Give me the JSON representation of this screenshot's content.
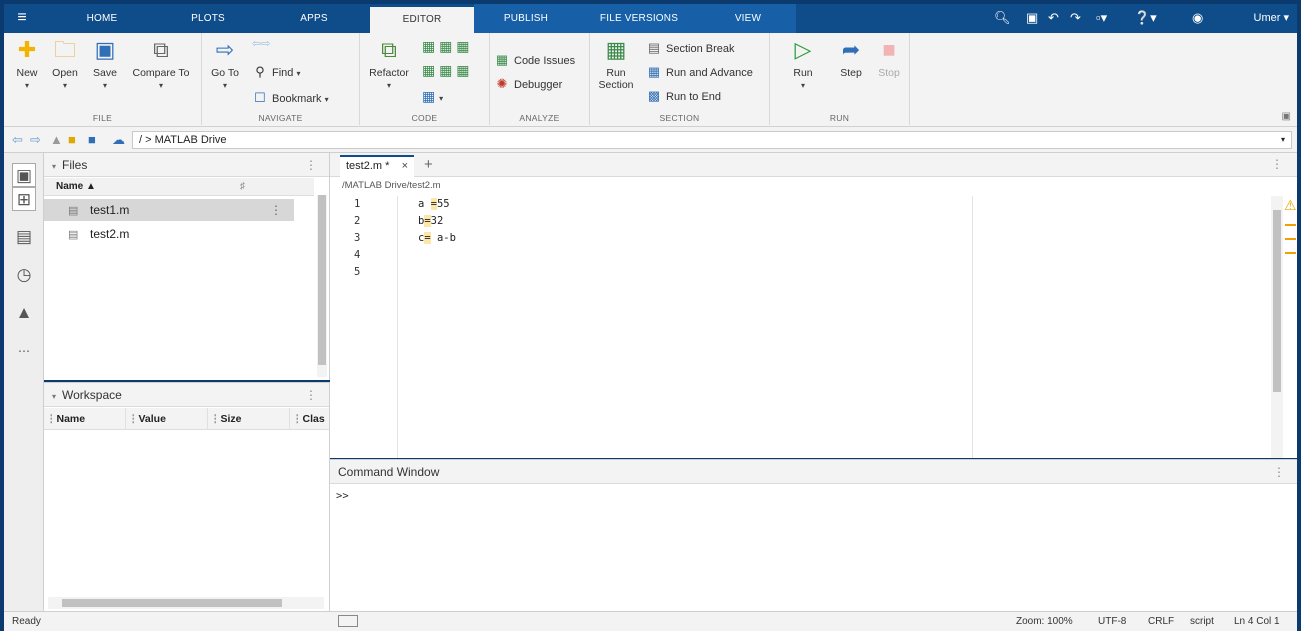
{
  "topbar": {
    "tabs": [
      "HOME",
      "PLOTS",
      "APPS",
      "EDITOR",
      "PUBLISH",
      "FILE VERSIONS",
      "VIEW"
    ],
    "active_tab": "EDITOR",
    "user": "Umer ▾"
  },
  "ribbon": {
    "file": {
      "label": "FILE",
      "new": "New",
      "open": "Open",
      "save": "Save",
      "compare": "Compare To"
    },
    "navigate": {
      "label": "NAVIGATE",
      "goto": "Go To",
      "find": "Find",
      "bookmark": "Bookmark"
    },
    "code": {
      "label": "CODE",
      "refactor": "Refactor"
    },
    "analyze": {
      "label": "ANALYZE",
      "code_issues": "Code Issues",
      "debugger": "Debugger"
    },
    "section": {
      "label": "SECTION",
      "run_section": "Run\nSection",
      "run_section_line1": "Run",
      "run_section_line2": "Section",
      "section_break": "Section Break",
      "run_and_advance": "Run and Advance",
      "run_to_end": "Run to End"
    },
    "run": {
      "label": "RUN",
      "run": "Run",
      "step": "Step",
      "stop": "Stop"
    }
  },
  "address": {
    "path": "/ > MATLAB Drive"
  },
  "files_panel": {
    "title": "Files",
    "col_name": "Name ▲",
    "files": [
      "test1.m",
      "test2.m"
    ],
    "selected": "test1.m"
  },
  "workspace_panel": {
    "title": "Workspace",
    "columns": [
      "Name",
      "Value",
      "Size",
      "Clas"
    ]
  },
  "editor": {
    "tab_label": "test2.m *",
    "breadcrumb": "/MATLAB Drive/test2.m",
    "line_numbers": [
      "1",
      "2",
      "3",
      "4",
      "5"
    ],
    "lines": [
      {
        "pre": "a ",
        "hl": "=",
        "post": "55"
      },
      {
        "pre": "b",
        "hl": "=",
        "post": "32"
      },
      {
        "pre": "c",
        "hl": "=",
        "post": " a-b"
      },
      {
        "pre": "",
        "hl": "",
        "post": ""
      },
      {
        "pre": "",
        "hl": "",
        "post": ""
      }
    ]
  },
  "command_window": {
    "title": "Command Window",
    "prompt": ">>"
  },
  "status": {
    "left": "Ready",
    "zoom": "Zoom: 100%",
    "encoding": "UTF-8",
    "eol": "CRLF",
    "type": "script",
    "position": "Ln 4  Col 1"
  }
}
